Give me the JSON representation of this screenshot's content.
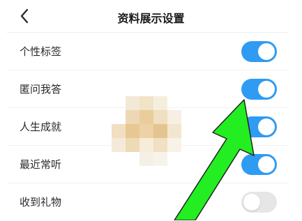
{
  "header": {
    "title": "资料展示设置",
    "back_icon": "chevron-left-icon"
  },
  "settings": [
    {
      "label": "个性标签",
      "enabled": true
    },
    {
      "label": "匿问我答",
      "enabled": true
    },
    {
      "label": "人生成就",
      "enabled": true
    },
    {
      "label": "最近常听",
      "enabled": true
    },
    {
      "label": "收到礼物",
      "enabled": false
    }
  ],
  "colors": {
    "toggle_on": "#2f9bf3",
    "toggle_off": "#e6e6e6",
    "annotation_arrow": "#22ee22"
  }
}
